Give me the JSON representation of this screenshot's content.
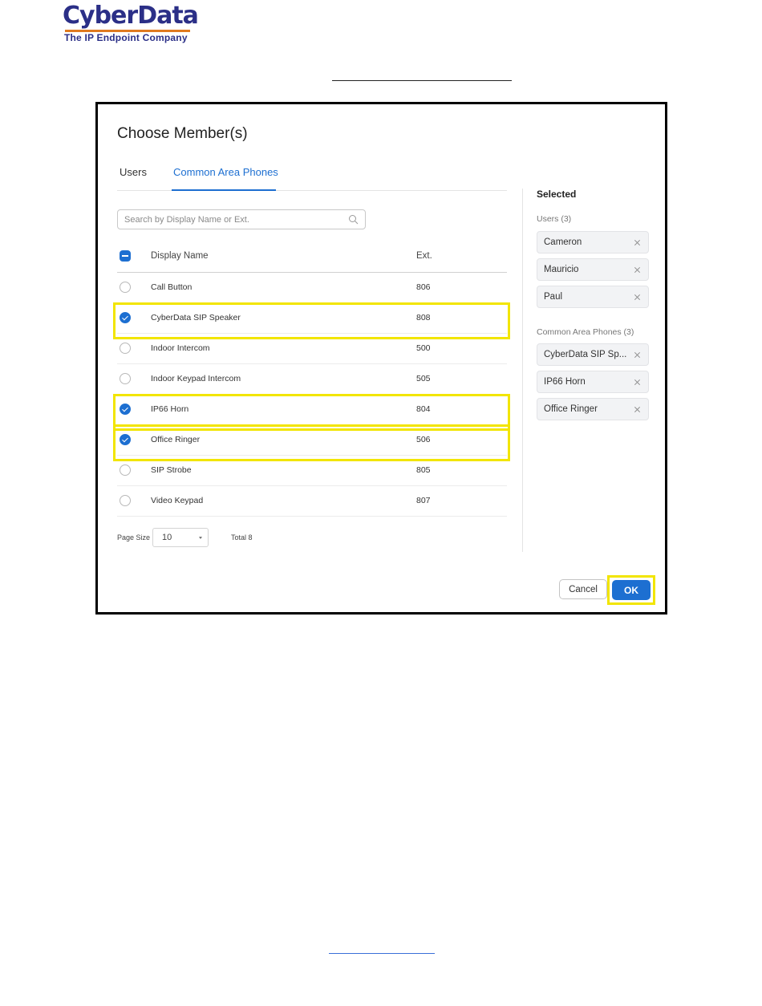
{
  "header": {
    "logo_text": "CyberData",
    "logo_tagline": "The IP Endpoint Company"
  },
  "dialog": {
    "title": "Choose Member(s)",
    "tabs": [
      {
        "label": "Users",
        "active": false
      },
      {
        "label": "Common Area Phones",
        "active": true
      }
    ],
    "search": {
      "placeholder": "Search by Display Name or Ext.",
      "value": ""
    },
    "table": {
      "columns": [
        "Display Name",
        "Ext."
      ],
      "rows": [
        {
          "name": "Call Button",
          "ext": "806",
          "checked": false
        },
        {
          "name": "CyberData SIP Speaker",
          "ext": "808",
          "checked": true
        },
        {
          "name": "Indoor Intercom",
          "ext": "500",
          "checked": false
        },
        {
          "name": "Indoor Keypad Intercom",
          "ext": "505",
          "checked": false
        },
        {
          "name": "IP66 Horn",
          "ext": "804",
          "checked": true
        },
        {
          "name": "Office Ringer",
          "ext": "506",
          "checked": true
        },
        {
          "name": "SIP Strobe",
          "ext": "805",
          "checked": false
        },
        {
          "name": "Video Keypad",
          "ext": "807",
          "checked": false
        }
      ]
    },
    "pagination": {
      "page_size_label": "Page Size",
      "page_size": "10",
      "total_label": "Total 8"
    },
    "selected": {
      "title": "Selected",
      "groups": [
        {
          "label": "Users (3)",
          "items": [
            "Cameron",
            "Mauricio",
            "Paul"
          ]
        },
        {
          "label": "Common Area Phones (3)",
          "items": [
            "CyberData SIP Sp...",
            "IP66 Horn",
            "Office Ringer"
          ]
        }
      ]
    },
    "buttons": {
      "cancel": "Cancel",
      "ok": "OK"
    }
  },
  "colors": {
    "accent": "#1d6fd1",
    "highlight": "#f2e500",
    "logo_blue": "#2b2f87",
    "logo_orange": "#e07a1f"
  }
}
